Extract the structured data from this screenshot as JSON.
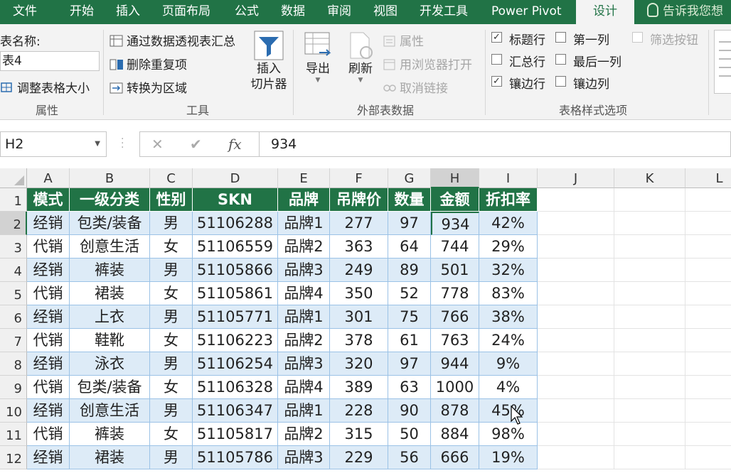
{
  "tabs": [
    {
      "label": "文件"
    },
    {
      "label": "开始"
    },
    {
      "label": "插入"
    },
    {
      "label": "页面布局"
    },
    {
      "label": "公式"
    },
    {
      "label": "数据"
    },
    {
      "label": "审阅"
    },
    {
      "label": "视图"
    },
    {
      "label": "开发工具"
    },
    {
      "label": "Power Pivot"
    },
    {
      "label": "设计"
    }
  ],
  "tell_me": "告诉我您想",
  "ribbon": {
    "props": {
      "table_name_label": "表名称:",
      "table_name_value": "表4",
      "resize": "调整表格大小",
      "group": "属性"
    },
    "tools": {
      "pivot": "通过数据透视表汇总",
      "dedupe": "删除重复项",
      "convert": "转换为区域",
      "slicer_line1": "插入",
      "slicer_line2": "切片器",
      "group": "工具"
    },
    "external": {
      "export": "导出",
      "refresh": "刷新",
      "properties": "属性",
      "open_browser": "用浏览器打开",
      "unlink": "取消链接",
      "group": "外部表数据"
    },
    "style_opts": {
      "header_row": "标题行",
      "first_col": "第一列",
      "filter_btn": "筛选按钮",
      "total_row": "汇总行",
      "last_col": "最后一列",
      "banded_rows": "镶边行",
      "banded_cols": "镶边列",
      "group": "表格样式选项",
      "checks": {
        "header_row": "✓",
        "banded_rows": "✓"
      }
    }
  },
  "formula": {
    "name_box": "H2",
    "cancel": "✕",
    "enter": "✔",
    "fx": "fx",
    "value": "934"
  },
  "columns": [
    "A",
    "B",
    "C",
    "D",
    "E",
    "F",
    "G",
    "H",
    "I",
    "J",
    "K",
    "L"
  ],
  "rows": [
    "1",
    "2",
    "3",
    "4",
    "5",
    "6",
    "7",
    "8",
    "9",
    "10",
    "11",
    "12"
  ],
  "table": {
    "headers": [
      "模式",
      "一级分类",
      "性别",
      "SKN",
      "品牌",
      "吊牌价",
      "数量",
      "金额",
      "折扣率"
    ],
    "data": [
      [
        "经销",
        "包类/装备",
        "男",
        "51106288",
        "品牌1",
        "277",
        "97",
        "934",
        "42%"
      ],
      [
        "代销",
        "创意生活",
        "女",
        "51106559",
        "品牌2",
        "363",
        "64",
        "744",
        "29%"
      ],
      [
        "经销",
        "裤装",
        "男",
        "51105866",
        "品牌3",
        "249",
        "89",
        "501",
        "32%"
      ],
      [
        "代销",
        "裙装",
        "女",
        "51105861",
        "品牌4",
        "350",
        "52",
        "778",
        "83%"
      ],
      [
        "经销",
        "上衣",
        "男",
        "51105771",
        "品牌1",
        "301",
        "75",
        "766",
        "38%"
      ],
      [
        "代销",
        "鞋靴",
        "女",
        "51106223",
        "品牌2",
        "378",
        "61",
        "763",
        "24%"
      ],
      [
        "经销",
        "泳衣",
        "男",
        "51106254",
        "品牌3",
        "320",
        "97",
        "944",
        "9%"
      ],
      [
        "代销",
        "包类/装备",
        "女",
        "51106328",
        "品牌4",
        "389",
        "63",
        "1000",
        "4%"
      ],
      [
        "经销",
        "创意生活",
        "男",
        "51106347",
        "品牌1",
        "228",
        "90",
        "878",
        "45%"
      ],
      [
        "代销",
        "裤装",
        "女",
        "51105817",
        "品牌2",
        "315",
        "50",
        "884",
        "98%"
      ],
      [
        "经销",
        "裙装",
        "男",
        "51105786",
        "品牌3",
        "229",
        "56",
        "666",
        "19%"
      ]
    ]
  },
  "colors": {
    "brand": "#217346",
    "band": "#ddebf7"
  }
}
